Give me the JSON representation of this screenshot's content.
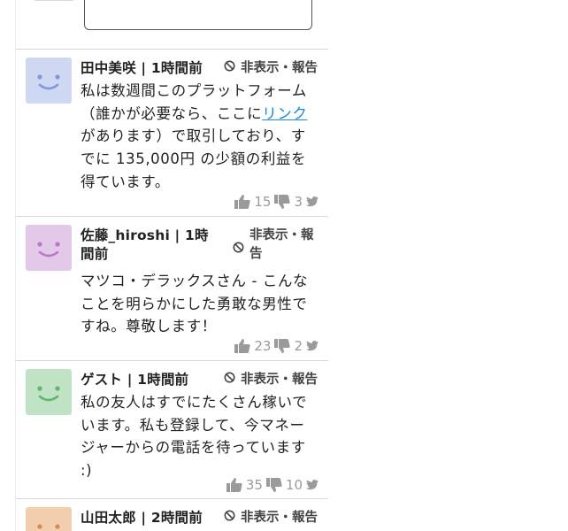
{
  "comments": [
    {
      "name": "田中美咲 | 1時間前",
      "hide": "非表示・報告",
      "text_before": "私は数週間このプラットフォーム（誰かが必要なら、ここに",
      "link": "リンク",
      "text_after": "があります）で取引しており、すでに 135,000円 の少額の利益を得ています。",
      "likes": "15",
      "dislikes": "3",
      "avatar_color": "#cfd8f3",
      "face_color": "#7e98db"
    },
    {
      "name": "佐藤_hiroshi | 1時間前",
      "hide": "非表示・報告",
      "text": "マツコ・デラックスさん - こんなことを明らかにした勇敢な男性ですね。尊敬します！",
      "likes": "23",
      "dislikes": "2",
      "avatar_color": "#e4c8ea",
      "face_color": "#b87ac4"
    },
    {
      "name": "ゲスト | 1時間前",
      "hide": "非表示・報告",
      "text": "私の友人はすでにたくさん稼いでいます。私も登録して、今マネージャーからの電話を待っています :)",
      "likes": "35",
      "dislikes": "10",
      "avatar_color": "#bfe3c4",
      "face_color": "#5fb46e"
    },
    {
      "name": "山田太郎 | 2時間前",
      "hide": "非表示・報告",
      "avatar_color": "#f3cfb0",
      "face_color": "#d08d55"
    }
  ]
}
